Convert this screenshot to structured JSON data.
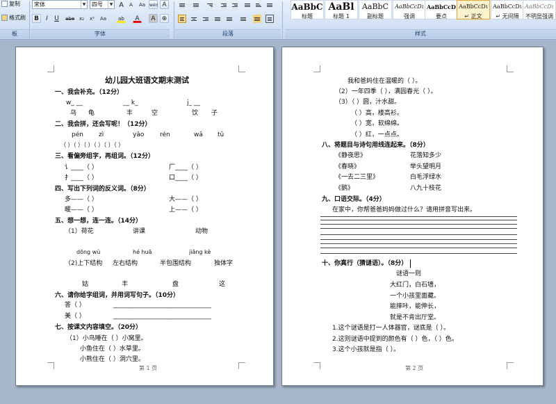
{
  "ribbon": {
    "clipboard": {
      "copy": "复制",
      "format_painter": "格式刷",
      "group": "板"
    },
    "font": {
      "name": "宋体",
      "size": "四号",
      "grow": "A",
      "shrink": "A",
      "clear": "Aa",
      "phonetic": "wén",
      "border": "A",
      "bold": "B",
      "italic": "I",
      "underline": "U",
      "strike": "abe",
      "sub": "x₂",
      "sup": "x²",
      "change_case": "Aa",
      "highlight": "ab",
      "font_color": "A",
      "shade": "A",
      "enclose": "⊕",
      "group": "字体"
    },
    "paragraph": {
      "group": "段落"
    },
    "styles": {
      "group": "样式",
      "items": [
        {
          "sample": "AaBbC",
          "name": "标题"
        },
        {
          "sample": "AaBl",
          "name": "标题 1"
        },
        {
          "sample": "AaBbC",
          "name": "副标题"
        },
        {
          "sample": "AaBbCcDι",
          "name": "强调"
        },
        {
          "sample": "AaBbCcD",
          "name": "要点"
        },
        {
          "sample": "AaBbCcDι",
          "name": "↵ 正文"
        },
        {
          "sample": "AaBbCcDι",
          "name": "↵ 无间隔"
        },
        {
          "sample": "AaBbCcDι",
          "name": "不明显强调"
        }
      ]
    }
  },
  "page1": {
    "title": "幼儿园大班语文期末测试",
    "s1": {
      "heading": "一、我会补充。（12分）",
      "pinyin": [
        "w_  __",
        "__  k_",
        "j_  __"
      ],
      "chars": [
        "乌",
        "龟",
        "丰",
        "空",
        "饮",
        "子"
      ]
    },
    "s2": {
      "heading": "二、我会拼，还会写呢！（12分）",
      "pinyin": [
        "pén",
        "zì",
        "yǎo",
        "rén",
        "wǎ",
        "tǔ"
      ],
      "blanks": "（     ）（     ）（     ）（     ）（     ）（     ）"
    },
    "s3": {
      "heading": "三、看偏旁组字，再组词。（12分）",
      "rows": [
        "讠____（      ）",
        "厂____（      ）",
        "扌____（      ）",
        "口____（      ）"
      ]
    },
    "s4": {
      "heading": "四、写出下列词的反义词。（8分）",
      "rows": [
        "多——（      ）",
        "大——（      ）",
        "暖——（      ）",
        "上——（      ）"
      ]
    },
    "s5": {
      "heading": "五、想一想，连一连。（14分）",
      "r1": [
        "（1）荷花",
        "讲课",
        "动物"
      ],
      "r2": [
        "dōng wù",
        "hé huā",
        "jiǎng kè"
      ],
      "r3": [
        "（2)上下结构",
        "左右结构",
        "半包围结构",
        "独体字"
      ],
      "r4": [
        "姑",
        "丰",
        "盘",
        "这"
      ]
    },
    "s6": {
      "heading": "六、请你给字组词，并用词写句子。（10分）",
      "rows": [
        "答（     ）",
        "美（     ）"
      ]
    },
    "s7": {
      "heading": "七、按课文内容填空。（20分）",
      "rows": [
        "（1）小鸟睡在（        ）小窝里。",
        "小鱼住在（        ）水草里。",
        "小熊住在（        ）洞穴里。"
      ]
    },
    "footer": "第 1 页"
  },
  "page2": {
    "top": [
      "我和爸妈住在温暖的（          ）。",
      "（2）一年四季（          ），满园春光（          ）。",
      "（3）（                  ）圆，汁水甜。",
      "（                  ）高，楼高衫。",
      "（                  ）宽，软绵绵。",
      "（                  ）红，一点点。"
    ],
    "s8": {
      "heading": "八、将题目与诗句用线连起来。（8分）",
      "left": [
        "《静夜思》",
        "《春晓》",
        "《一去二三里》",
        "《鹅》"
      ],
      "right": [
        "花落知多少",
        "举头望明月",
        "白毛浮绿水",
        "八九十枝花"
      ]
    },
    "s9": {
      "heading": "九、口语交际。（4分）",
      "prompt": "在家中，你帮爸爸妈妈做过什么？请用拼音写出来。"
    },
    "s10": {
      "heading": "十、你真行（猜谜语）。（8分）",
      "riddle_title": "谜语一则",
      "lines": [
        "大红门，白石墙，",
        "一个小孩里面藏。",
        "能摔咔，能伸长，",
        "就是不肯出厅堂。"
      ],
      "qs": [
        "1.这个谜语是打一人体器官，谜底是（          ）。",
        "2.这则谜语中提到的颜色有（          ）色，（          ）色。",
        "3.这个小孩就是指（          ）。"
      ]
    },
    "footer": "第 2 页"
  }
}
